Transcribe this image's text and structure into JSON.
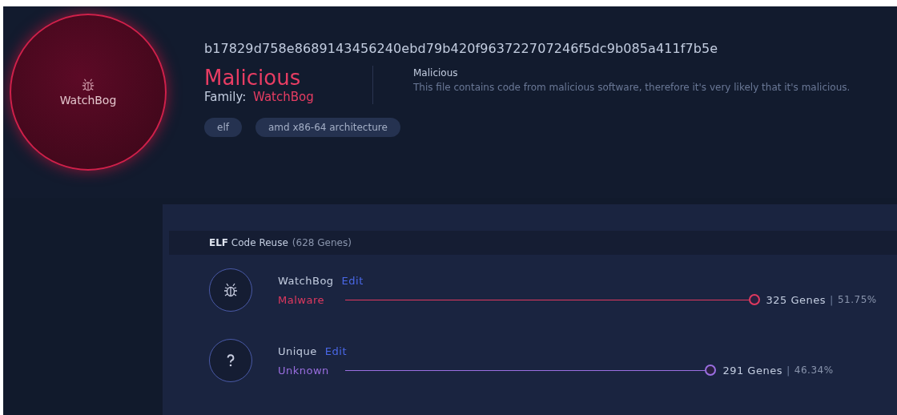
{
  "family_badge": {
    "label": "WatchBog"
  },
  "hash": "b17829d758e8689143456240ebd79b420f963722707246f5dc9b085a411f7b5e",
  "verdict": {
    "title": "Malicious",
    "family_label": "Family:",
    "family": "WatchBog",
    "heading": "Malicious",
    "description": "This file contains code from malicious software, therefore it's very likely that it's malicious."
  },
  "tags": [
    "elf",
    "amd x86-64 architecture"
  ],
  "code_reuse": {
    "title": "ELF",
    "subtitle": "Code Reuse",
    "count": "(628 Genes)",
    "rows": [
      {
        "kind": "malware",
        "name": "WatchBog",
        "edit": "Edit",
        "category": "Malware",
        "genes": "325 Genes",
        "separator": "|",
        "percent": "51.75%",
        "color": "#e0395f"
      },
      {
        "kind": "unknown",
        "name": "Unique",
        "edit": "Edit",
        "category": "Unknown",
        "genes": "291 Genes",
        "separator": "|",
        "percent": "46.34%",
        "color": "#9a6ee0"
      }
    ]
  }
}
